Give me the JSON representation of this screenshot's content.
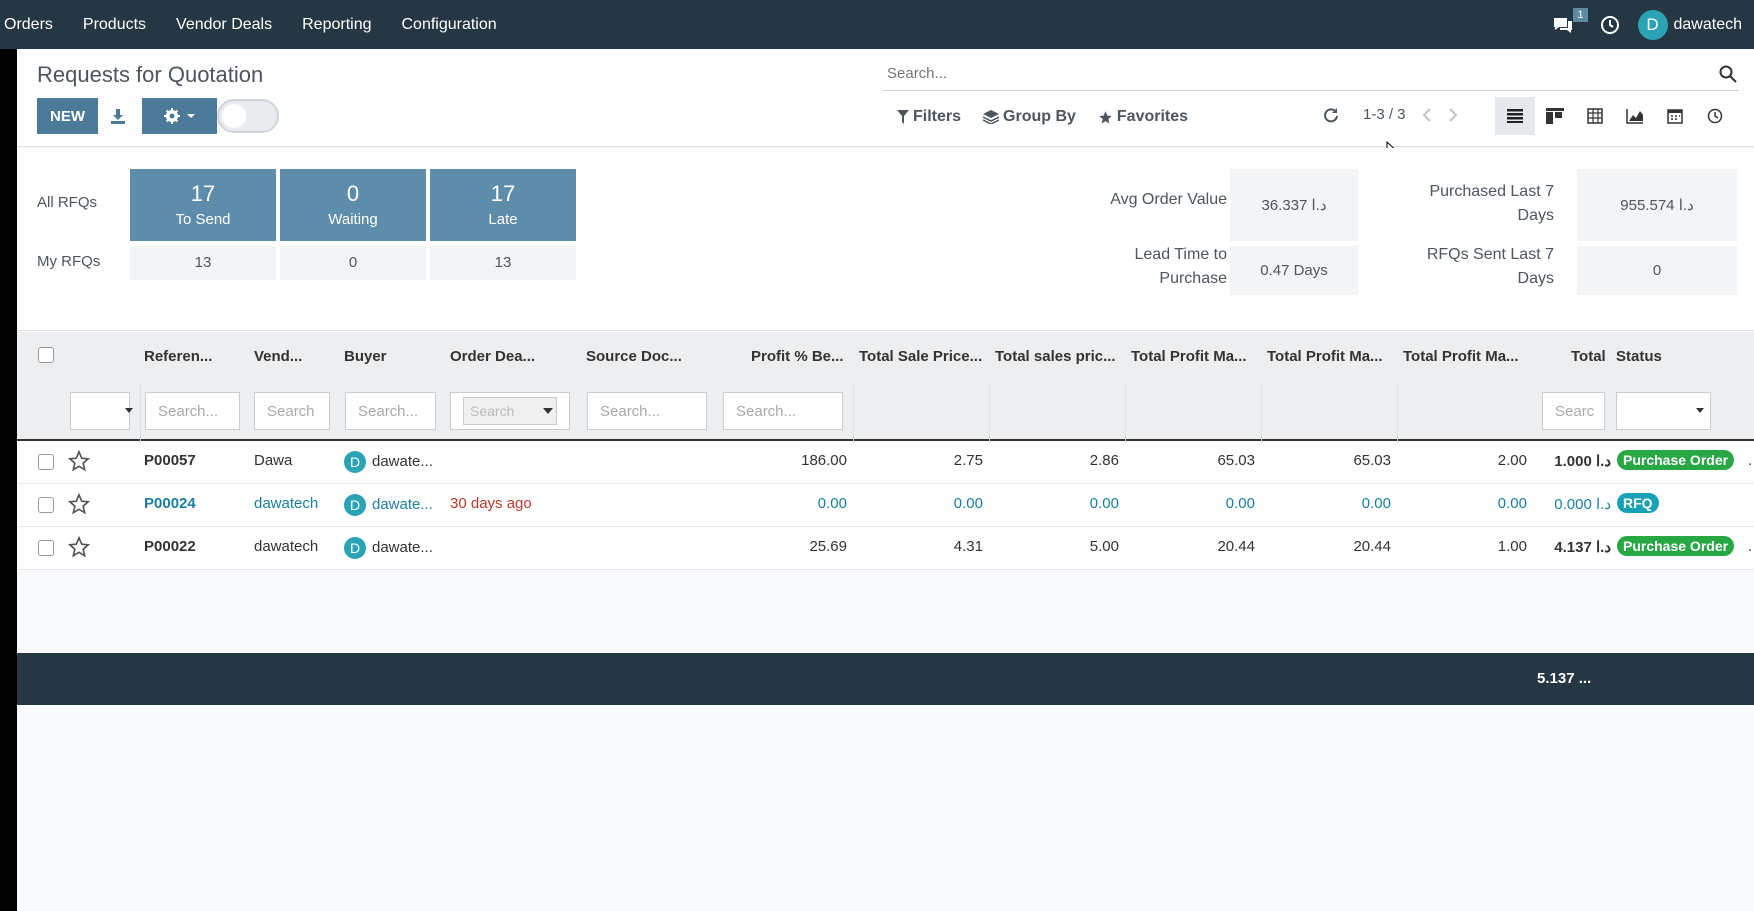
{
  "nav": {
    "items": [
      "Orders",
      "Products",
      "Vendor Deals",
      "Reporting",
      "Configuration"
    ],
    "message_count": "1",
    "avatar_letter": "D",
    "user": "dawatech"
  },
  "control": {
    "title": "Requests for Quotation",
    "new_label": "NEW",
    "search_placeholder": "Search...",
    "filters_label": "Filters",
    "groupby_label": "Group By",
    "favorites_label": "Favorites",
    "pager": "1-3 / 3"
  },
  "dashboard": {
    "all_rfqs_label": "All RFQs",
    "my_rfqs_label": "My RFQs",
    "to_send": {
      "count": "17",
      "label": "To Send",
      "mine": "13"
    },
    "waiting": {
      "count": "0",
      "label": "Waiting",
      "mine": "0"
    },
    "late": {
      "count": "17",
      "label": "Late",
      "mine": "13"
    },
    "avg_order_label": "Avg Order Value",
    "avg_order_value": "36.337 د.ا",
    "purchased_label_1": "Purchased Last 7",
    "purchased_label_2": "Days",
    "purchased_value": "955.574 د.ا",
    "lead_time_label_1": "Lead Time to",
    "lead_time_label_2": "Purchase",
    "lead_time_value": "0.47 Days",
    "rfqs_sent_label_1": "RFQs Sent Last 7",
    "rfqs_sent_label_2": "Days",
    "rfqs_sent_value": "0"
  },
  "table": {
    "headers": {
      "reference": "Referen...",
      "vendor": "Vend...",
      "buyer": "Buyer",
      "order_deadline": "Order Dea...",
      "source_doc": "Source Doc...",
      "profit_pct": "Profit % Be...",
      "total_sale_price": "Total Sale Price...",
      "total_sales_price": "Total sales pric...",
      "total_profit_1": "Total Profit Ma...",
      "total_profit_2": "Total Profit Ma...",
      "total_profit_3": "Total Profit Ma...",
      "total": "Total",
      "status": "Status"
    },
    "filter_placeholders": {
      "reference": "Search...",
      "vendor": "Search",
      "buyer": "Search...",
      "deadline": "Search",
      "source": "Search...",
      "profit": "Search...",
      "total": "Searc"
    },
    "rows": [
      {
        "ref": "P00057",
        "vendor": "Dawa",
        "buyer_letter": "D",
        "buyer": "dawate...",
        "deadline": "",
        "profit": "186.00",
        "sale": "2.75",
        "sales": "2.86",
        "pm1": "65.03",
        "pm2": "65.03",
        "pm3": "2.00",
        "total": "1.000 د.ا",
        "status": "Purchase Order"
      },
      {
        "ref": "P00024",
        "vendor": "dawatech",
        "buyer_letter": "D",
        "buyer": "dawate...",
        "deadline": "30 days ago",
        "profit": "0.00",
        "sale": "0.00",
        "sales": "0.00",
        "pm1": "0.00",
        "pm2": "0.00",
        "pm3": "0.00",
        "total": "0.000 د.ا",
        "status": "RFQ"
      },
      {
        "ref": "P00022",
        "vendor": "dawatech",
        "buyer_letter": "D",
        "buyer": "dawate...",
        "deadline": "",
        "profit": "25.69",
        "sale": "4.31",
        "sales": "5.00",
        "pm1": "20.44",
        "pm2": "20.44",
        "pm3": "1.00",
        "total": "4.137 د.ا",
        "status": "Purchase Order"
      }
    ],
    "footer_total": "5.137 ...",
    "status_trail": "."
  },
  "colors": {
    "navbar": "#243742",
    "primary": "#4c7a99",
    "tile": "#5d8dab",
    "success": "#28a745",
    "info": "#17a2b8",
    "link": "#1a7fa3",
    "danger": "#c0392b"
  },
  "icons": [
    "chat-icon",
    "clock-icon",
    "download-icon",
    "gear-icon",
    "search-icon",
    "filter-icon",
    "layers-icon",
    "star-icon",
    "refresh-icon",
    "list-view-icon",
    "kanban-view-icon",
    "pivot-view-icon",
    "graph-view-icon",
    "calendar-view-icon",
    "activity-view-icon"
  ]
}
